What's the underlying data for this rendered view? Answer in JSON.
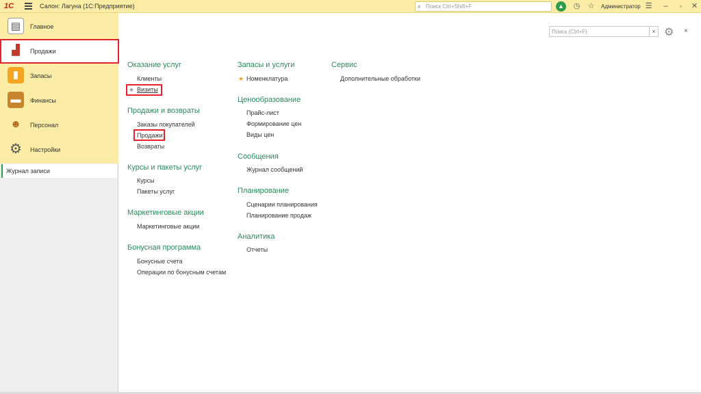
{
  "titlebar": {
    "app_title": "Салон: Лагуна  (1С:Предприятие)",
    "search_placeholder": "Поиск Ctrl+Shift+F",
    "user": "Администратор",
    "logo_text": "1С"
  },
  "sidebar": {
    "items": [
      {
        "label": "Главное",
        "icon": "clipboard-icon"
      },
      {
        "label": "Продажи",
        "icon": "sales-chart-icon"
      },
      {
        "label": "Запасы",
        "icon": "cosmetics-icon"
      },
      {
        "label": "Финансы",
        "icon": "wallet-icon"
      },
      {
        "label": "Персонал",
        "icon": "people-icon"
      },
      {
        "label": "Настройки",
        "icon": "gear-icon"
      }
    ],
    "journal": "Журнал записи"
  },
  "panel": {
    "search_placeholder": "Поиск (Ctrl+F)",
    "clear": "×",
    "close": "×"
  },
  "groups": {
    "col1": [
      {
        "title": "Оказание услуг",
        "items": [
          "Клиенты",
          "Визиты"
        ]
      },
      {
        "title": "Продажи и возвраты",
        "items": [
          "Заказы покупателей",
          "Продажи",
          "Возвраты"
        ]
      },
      {
        "title": "Курсы и пакеты услуг",
        "items": [
          "Курсы",
          "Пакеты услуг"
        ]
      },
      {
        "title": "Маркетинговые акции",
        "items": [
          "Маркетинговые акции"
        ]
      },
      {
        "title": "Бонусная программа",
        "items": [
          "Бонусные счета",
          "Операции по бонусным счетам"
        ]
      }
    ],
    "col2": [
      {
        "title": "Запасы и услуги",
        "items": [
          "Номенклатура"
        ]
      },
      {
        "title": "Ценообразование",
        "items": [
          "Прайс-лист",
          "Формирование цен",
          "Виды цен"
        ]
      },
      {
        "title": "Сообщения",
        "items": [
          "Журнал сообщений"
        ]
      },
      {
        "title": "Планирование",
        "items": [
          "Сценарии планирования",
          "Планирование продаж"
        ]
      },
      {
        "title": "Аналитика",
        "items": [
          "Отчеты"
        ]
      }
    ],
    "col3": [
      {
        "title": "Сервис",
        "items": [
          "Дополнительные обработки"
        ]
      }
    ]
  },
  "colors": {
    "accent": "#2a8a5c",
    "titlebar": "#fbeca6",
    "highlight": "#e8202a",
    "star_active": "#f0a020",
    "star_inactive": "#999999"
  }
}
